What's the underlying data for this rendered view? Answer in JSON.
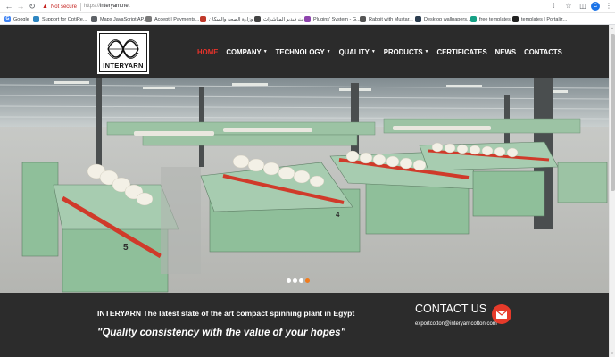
{
  "browser": {
    "security_label": "Not secure",
    "url_scheme": "https://",
    "url_host": "interyarn.net",
    "profile_initial": "C"
  },
  "bookmarks": [
    {
      "label": "Google",
      "icon": "google-icon",
      "color": "#4285f4"
    },
    {
      "label": "Support for OptiRe...",
      "icon": "globe-icon",
      "color": "#2e86c1"
    },
    {
      "label": "Maps JavaScript AP...",
      "icon": "maps-icon",
      "color": "#5f6368"
    },
    {
      "label": "Accept | Payments...",
      "icon": "payments-icon",
      "color": "#7a7a7a"
    },
    {
      "label": "وزارة الصحة والسكان ...",
      "icon": "ministry-icon",
      "color": "#c0392b"
    },
    {
      "label": "بث فيديو المباشرات",
      "icon": "globe-icon",
      "color": "#444444"
    },
    {
      "label": "Plugins' System - G...",
      "icon": "plugins-icon",
      "color": "#8e44ad"
    },
    {
      "label": "Rabbit with Mustar...",
      "icon": "rabbit-icon",
      "color": "#555555"
    },
    {
      "label": "Desktop wallpapers...",
      "icon": "wallpaper-icon",
      "color": "#2c3e50"
    },
    {
      "label": "free templates",
      "icon": "template-icon",
      "color": "#16a085"
    },
    {
      "label": "templates | Portaliz...",
      "icon": "portal-icon",
      "color": "#222222"
    }
  ],
  "header": {
    "logo_text": "INTERYARN",
    "menu": [
      {
        "label": "HOME",
        "active": true,
        "dropdown": false
      },
      {
        "label": "COMPANY",
        "active": false,
        "dropdown": true
      },
      {
        "label": "TECHNOLOGY",
        "active": false,
        "dropdown": true
      },
      {
        "label": "QUALITY",
        "active": false,
        "dropdown": true
      },
      {
        "label": "PRODUCTS",
        "active": false,
        "dropdown": true
      },
      {
        "label": "CERTIFICATES",
        "active": false,
        "dropdown": false
      },
      {
        "label": "NEWS",
        "active": false,
        "dropdown": false
      },
      {
        "label": "CONTACTS",
        "active": false,
        "dropdown": false
      }
    ]
  },
  "hero": {
    "slide_count": 4,
    "active_slide": 4,
    "machine_numbers": [
      "5",
      "4"
    ]
  },
  "footer": {
    "tagline": "INTERYARN The latest state of the art compact spinning plant in Egypt",
    "quote": "\"Quality consistency with the value of your hopes\"",
    "contact_title": "CONTACT US",
    "contact_email": "exportcotton@interyarncotton.com"
  },
  "colors": {
    "accent_red": "#e8322a",
    "header_bg": "#2b2b2b",
    "slider_active_dot": "#f07c1e",
    "machine_green": "#8fbf9a"
  }
}
